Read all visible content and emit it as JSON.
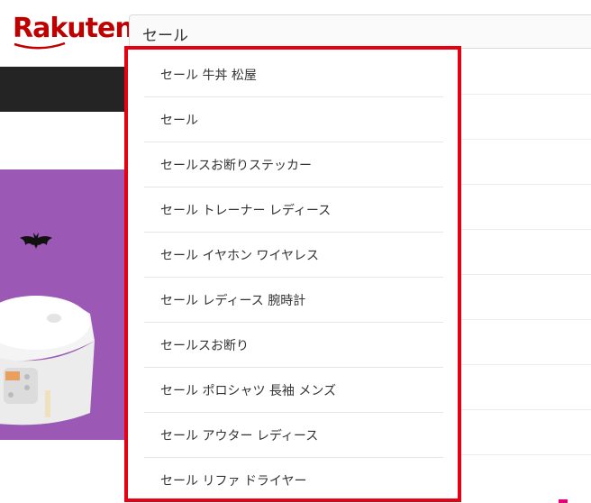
{
  "header": {
    "logo_text": "Rakuten",
    "search": {
      "value": "セール"
    }
  },
  "suggestions": [
    {
      "label": "セール 牛丼 松屋"
    },
    {
      "label": "セール"
    },
    {
      "label": "セールスお断りステッカー"
    },
    {
      "label": "セール トレーナー レディース"
    },
    {
      "label": "セール イヤホン ワイヤレス"
    },
    {
      "label": "セール レディース 腕時計"
    },
    {
      "label": "セールスお断り"
    },
    {
      "label": "セール ポロシャツ 長袖 メンズ"
    },
    {
      "label": "セール アウター レディース"
    },
    {
      "label": "セール リファ ドライヤー"
    }
  ],
  "colors": {
    "brand": "#bf0000",
    "highlight_border": "#e60012",
    "navbar": "#242424",
    "banner": "#9b59b5"
  },
  "icons": [
    "bat-icon",
    "rice-cooker-image"
  ]
}
